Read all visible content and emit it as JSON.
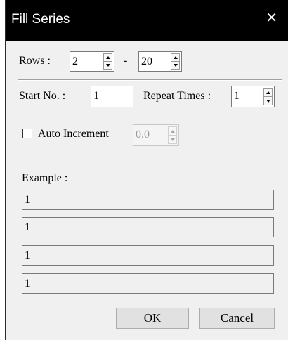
{
  "dialog": {
    "title": "Fill Series",
    "close_glyph": "✕"
  },
  "rows": {
    "label": "Rows :",
    "from_value": "2",
    "dash": "-",
    "to_value": "20"
  },
  "start": {
    "label": "Start No. :",
    "value": "1"
  },
  "repeat": {
    "label": "Repeat Times :",
    "value": "1"
  },
  "auto_increment": {
    "label": "Auto Increment",
    "checked": false,
    "value": "0.0"
  },
  "example": {
    "label": "Example :",
    "values": [
      "1",
      "1",
      "1",
      "1"
    ]
  },
  "buttons": {
    "ok": "OK",
    "cancel": "Cancel"
  }
}
